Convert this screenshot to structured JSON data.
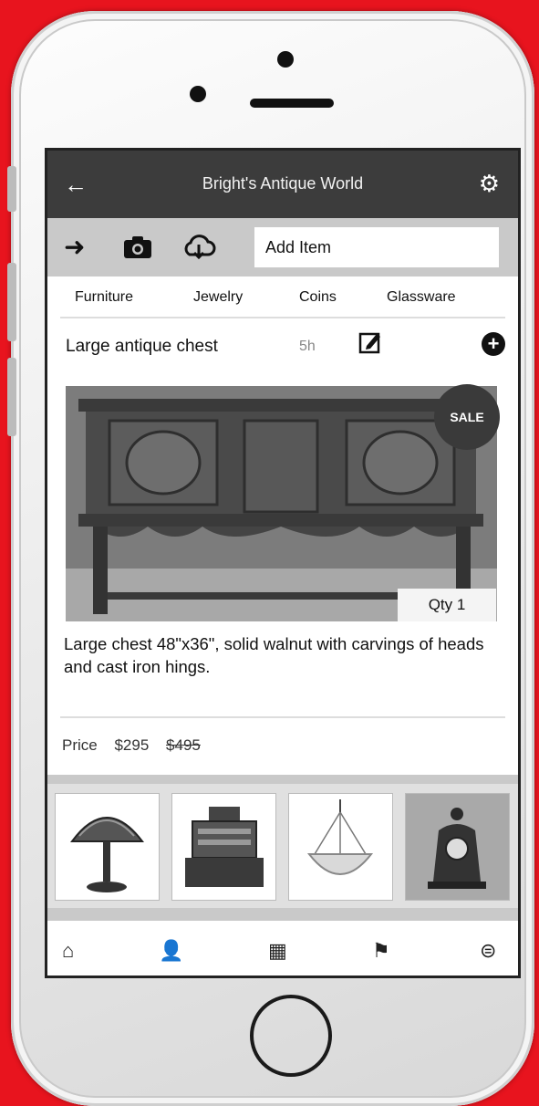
{
  "app": {
    "title": "Bright's Antique World"
  },
  "toolbar": {
    "add_item_value": "Add Item"
  },
  "categories": [
    "Furniture",
    "Jewelry",
    "Coins",
    "Glassware"
  ],
  "item": {
    "title": "Large antique chest",
    "age": "5h",
    "badge": "SALE",
    "qty": "Qty  1",
    "description": "Large chest 48\"x36\", solid walnut with carvings of heads and cast iron hings.",
    "price_label": "Price",
    "price_sale": "$295",
    "price_original": "$495"
  },
  "thumbnails": [
    "tiffany-lamp",
    "cash-register",
    "chandelier",
    "mantel-clock"
  ],
  "nav": [
    "home-icon",
    "user-icon",
    "bag-icon",
    "bell-icon",
    "menu-icon"
  ],
  "colors": {
    "background": "#e8141e",
    "topbar": "#3c3c3c",
    "toolbar": "#c9c9c9"
  }
}
